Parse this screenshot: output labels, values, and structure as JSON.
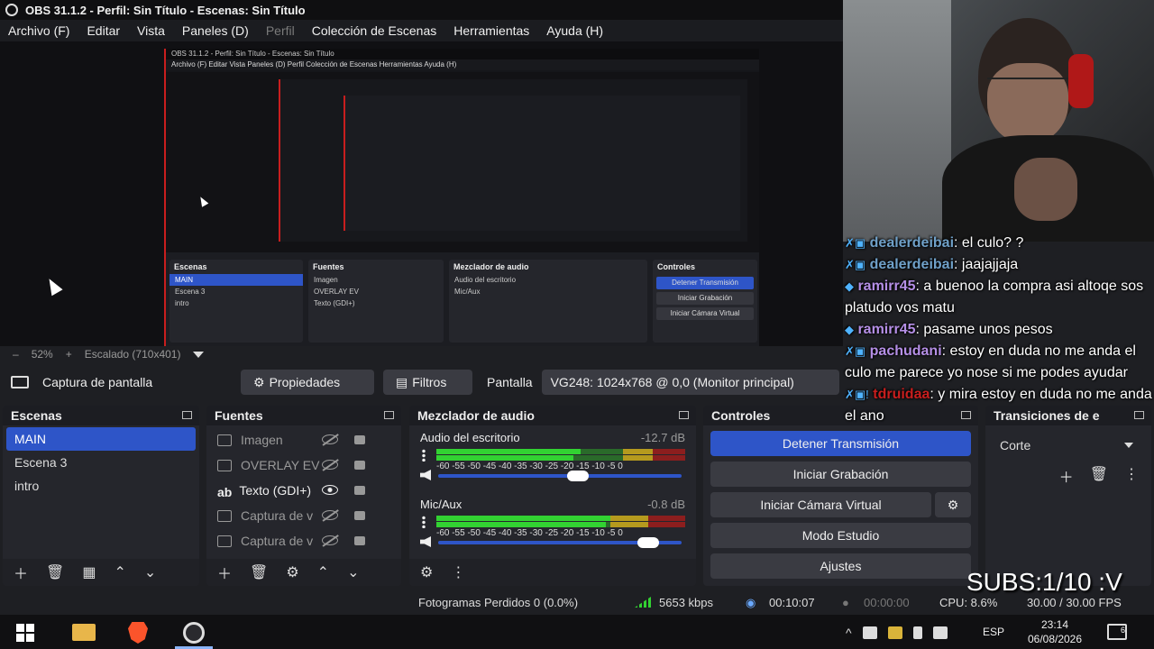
{
  "window": {
    "title": "OBS 31.1.2 - Perfil: Sin Título - Escenas: Sin Título"
  },
  "menu": [
    {
      "label": "Archivo (F)",
      "disabled": false
    },
    {
      "label": "Editar",
      "disabled": false
    },
    {
      "label": "Vista",
      "disabled": false
    },
    {
      "label": "Paneles (D)",
      "disabled": false
    },
    {
      "label": "Perfil",
      "disabled": true
    },
    {
      "label": "Colección de Escenas",
      "disabled": false
    },
    {
      "label": "Herramientas",
      "disabled": false
    },
    {
      "label": "Ayuda (H)",
      "disabled": false
    }
  ],
  "preview": {
    "zoom_out": "–",
    "zoom": "52%",
    "zoom_in": "+",
    "scale": "Escalado (710x401)"
  },
  "source_toolbar": {
    "source_name": "Captura de pantalla",
    "properties": "Propiedades",
    "filters": "Filtros",
    "screen_label": "Pantalla",
    "screen_value": "VG248: 1024x768 @ 0,0 (Monitor principal)"
  },
  "scenes": {
    "title": "Escenas",
    "items": [
      "MAIN",
      "Escena 3",
      "intro"
    ],
    "selected": "MAIN"
  },
  "sources": {
    "title": "Fuentes",
    "items": [
      {
        "label": "Imagen",
        "visible": false
      },
      {
        "label": "OVERLAY EV",
        "visible": false
      },
      {
        "label": "Texto (GDI+)",
        "visible": true
      },
      {
        "label": "Captura de v",
        "visible": false
      },
      {
        "label": "Captura de v",
        "visible": false
      }
    ]
  },
  "mixer": {
    "title": "Mezclador de audio",
    "channels": [
      {
        "name": "Audio del escritorio",
        "level": "-12.7 dB",
        "volume": 0.58
      },
      {
        "name": "Mic/Aux",
        "level": "-0.8 dB",
        "volume": 0.9
      }
    ],
    "scale": "-60 -55 -50 -45 -40 -35 -30 -25 -20 -15 -10 -5 0"
  },
  "controls": {
    "title": "Controles",
    "stop_stream": "Detener Transmisión",
    "start_recording": "Iniciar Grabación",
    "start_virtual_cam": "Iniciar Cámara Virtual",
    "studio_mode": "Modo Estudio",
    "settings": "Ajustes"
  },
  "transitions": {
    "title": "Transiciones de e",
    "selected": "Corte"
  },
  "status": {
    "dropped_frames": "Fotogramas Perdidos 0 (0.0%)",
    "bitrate": "5653 kbps",
    "stream_time": "00:10:07",
    "record_time": "00:00:00",
    "cpu": "CPU: 8.6%",
    "fps": "30.00 / 30.00 FPS"
  },
  "taskbar": {
    "language": "ESP",
    "time": "23:14",
    "date": "06/08/2026",
    "notifications": "6"
  },
  "chat": [
    {
      "badges": "✗▣",
      "user": "dealerdeibai",
      "text": ": el culo? ?",
      "user_class": "u1"
    },
    {
      "badges": "✗▣",
      "user": "dealerdeibai",
      "text": ": jaajajjaja",
      "user_class": "u1"
    },
    {
      "badges": "◆",
      "user": "ramirr45",
      "text": ": a buenoo la compra asi altoqe sos platudo vos matu",
      "user_class": "u2"
    },
    {
      "badges": "◆",
      "user": "ramirr45",
      "text": ": pasame unos pesos",
      "user_class": "u2"
    },
    {
      "badges": "✗▣",
      "user": "pachudani",
      "text": ": estoy en duda no me anda el culo me parece yo nose si me podes ayudar",
      "user_class": "u3"
    },
    {
      "badges": "✗▣!",
      "user": "tdruidaa",
      "text": ": y mira estoy en duda no me anda el ano",
      "user_class": "u4"
    }
  ],
  "overlay_text": "SUBS:1/10 :V",
  "nested_preview": {
    "title": "OBS 31.1.2 - Perfil: Sin Título - Escenas: Sin Título",
    "menu": "Archivo (F)   Editar   Vista   Paneles (D)   Perfil   Colección de Escenas   Herramientas   Ayuda (H)"
  }
}
